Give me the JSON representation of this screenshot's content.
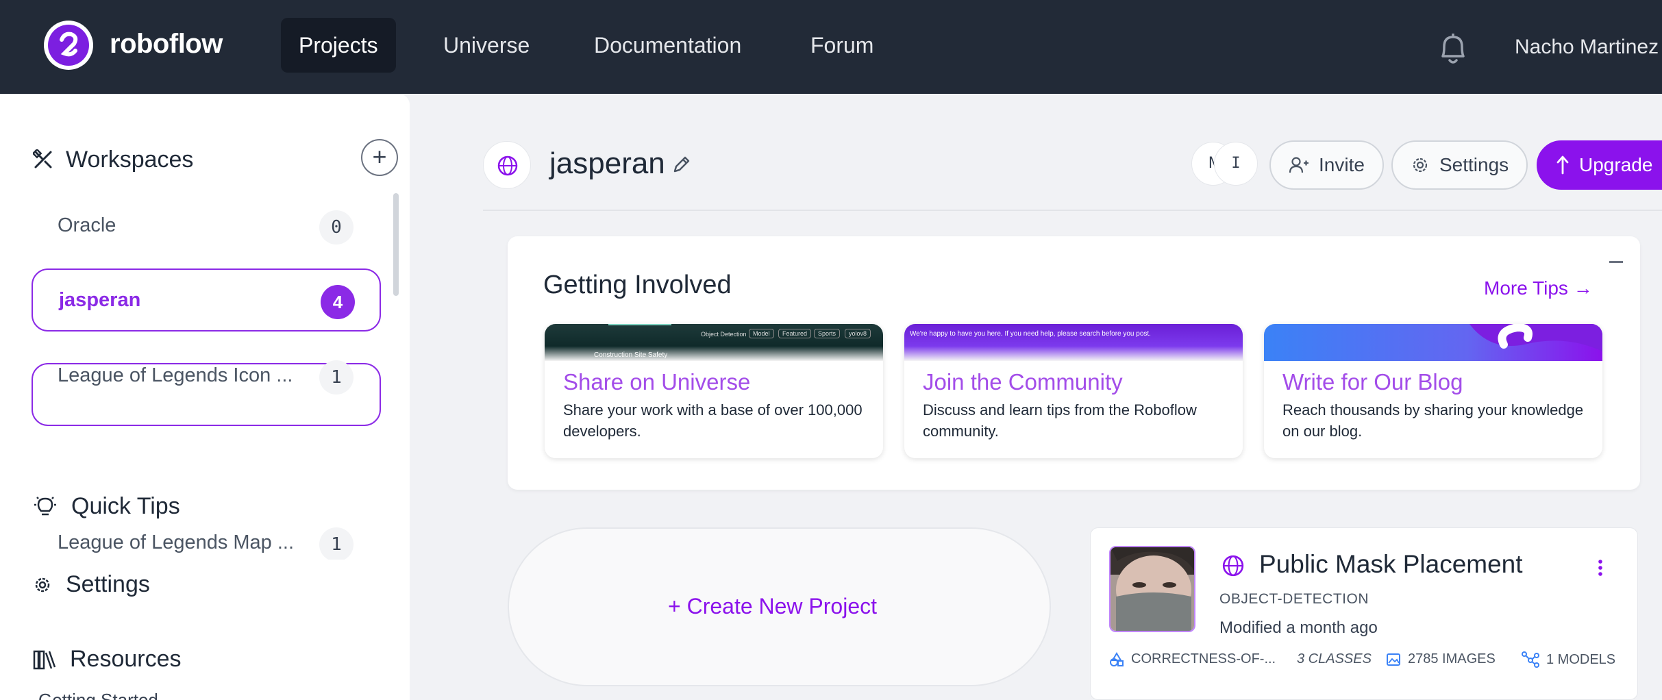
{
  "nav": {
    "brand": "roboflow",
    "links": [
      {
        "label": "Projects",
        "active": true
      },
      {
        "label": "Universe",
        "active": false
      },
      {
        "label": "Documentation",
        "active": false
      },
      {
        "label": "Forum",
        "active": false
      }
    ],
    "user_name": "Nacho Martinez"
  },
  "sidebar": {
    "workspaces_heading": "Workspaces",
    "add_symbol": "+",
    "workspaces": [
      {
        "label": "Oracle",
        "count": "0",
        "selected": false
      },
      {
        "label": "jasperan",
        "count": "4",
        "selected": true
      },
      {
        "label": "League of Legends Icon ...",
        "count": "1",
        "selected": false
      },
      {
        "label": "League of Legends Map ...",
        "count": "1",
        "selected": false
      }
    ],
    "quick_tips": "Quick Tips",
    "settings": "Settings",
    "resources": "Resources",
    "getting_started": "Getting Started"
  },
  "header": {
    "workspace_name": "jasperan",
    "avatars": [
      "N",
      "I"
    ],
    "invite": "Invite",
    "settings": "Settings",
    "upgrade": "Upgrade"
  },
  "getting_involved": {
    "title": "Getting Involved",
    "more_tips": "More Tips →",
    "cards": [
      {
        "title": "Share on Universe",
        "desc": "Share your work with a base of over 100,000 developers.",
        "banner": "Construction Site Safety"
      },
      {
        "title": "Join the Community",
        "desc": "Discuss and learn tips from the Roboflow community.",
        "banner": "We're happy to have you here. If you need help, please search before you post."
      },
      {
        "title": "Write for Our Blog",
        "desc": "Reach thousands by sharing your knowledge on our blog.",
        "banner": ""
      }
    ],
    "universe_banner_tags": [
      "Object Detection",
      "Model",
      "Featured",
      "Sports",
      "yolov8"
    ]
  },
  "create_project": {
    "label": "+  Create New Project"
  },
  "project": {
    "title": "Public Mask Placement",
    "type": "OBJECT-DETECTION",
    "modified": "Modified a month ago",
    "annotation_group": "CORRECTNESS-OF-...",
    "classes": "3 CLASSES",
    "images": "2785 IMAGES",
    "models": "1 MODELS"
  },
  "colors": {
    "accent": "#8b12ec",
    "nav_bg": "#222a37",
    "card_title": "#a34de9"
  }
}
